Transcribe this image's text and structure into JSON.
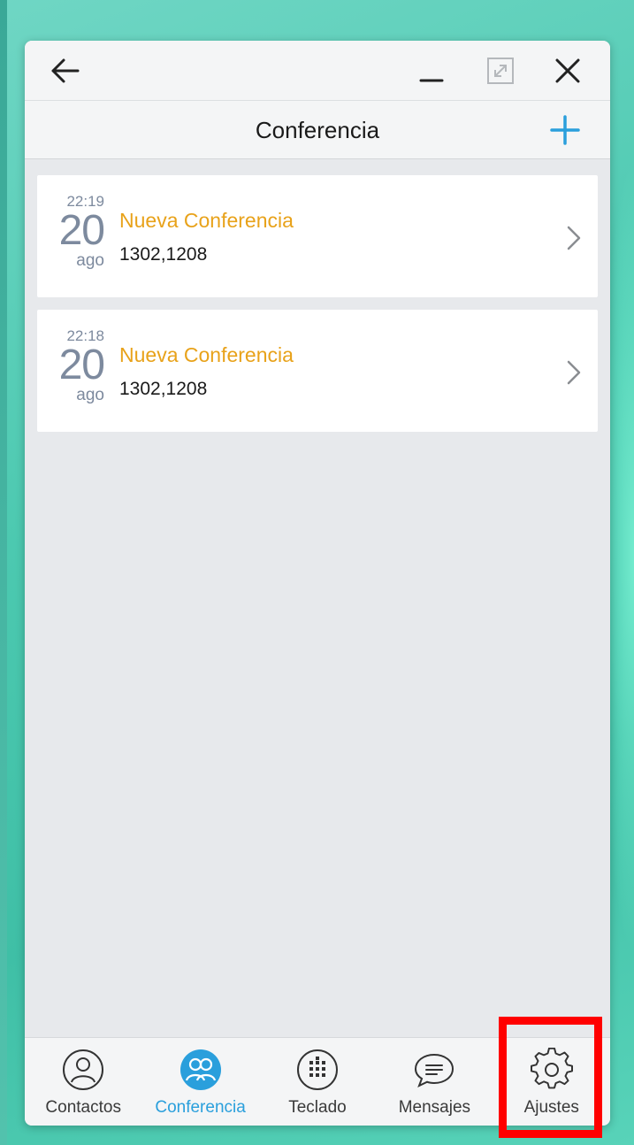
{
  "header": {
    "title": "Conferencia"
  },
  "conferences": [
    {
      "time": "22:19",
      "day": "20",
      "month": "ago",
      "title": "Nueva Conferencia",
      "participants": "1302,1208"
    },
    {
      "time": "22:18",
      "day": "20",
      "month": "ago",
      "title": "Nueva Conferencia",
      "participants": "1302,1208"
    }
  ],
  "tabs": [
    {
      "label": "Contactos",
      "icon": "contacts-icon"
    },
    {
      "label": "Conferencia",
      "icon": "conference-icon",
      "active": true
    },
    {
      "label": "Teclado",
      "icon": "keypad-icon"
    },
    {
      "label": "Mensajes",
      "icon": "messages-icon"
    },
    {
      "label": "Ajustes",
      "icon": "gear-icon"
    }
  ],
  "colors": {
    "accent": "#2a9fdc",
    "title_orange": "#e8a21a",
    "date_gray": "#7d8a9e",
    "highlight": "#ff0000"
  }
}
